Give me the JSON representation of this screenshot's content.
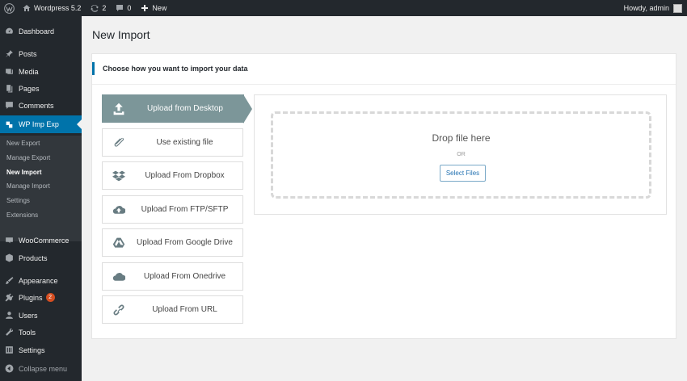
{
  "adminbar": {
    "site_name": "Wordpress 5.2",
    "updates_count": "2",
    "comments_count": "0",
    "new_label": "New",
    "greeting": "Howdy, admin"
  },
  "sidebar": {
    "items": {
      "dashboard": "Dashboard",
      "posts": "Posts",
      "media": "Media",
      "pages": "Pages",
      "comments": "Comments",
      "wp_imp_exp": "WP Imp Exp",
      "woocommerce": "WooCommerce",
      "products": "Products",
      "appearance": "Appearance",
      "plugins": "Plugins",
      "users": "Users",
      "tools": "Tools",
      "settings": "Settings",
      "collapse": "Collapse menu"
    },
    "plugins_badge": "2",
    "submenu": [
      "New Export",
      "Manage Export",
      "New Import",
      "Manage Import",
      "Settings",
      "Extensions"
    ],
    "submenu_current": "New Import",
    "accent_color": "#0073aa"
  },
  "page": {
    "title": "New Import",
    "section_heading": "Choose how you want to import your data"
  },
  "import_options": [
    {
      "label": "Upload from Desktop",
      "icon": "upload-icon",
      "active": true
    },
    {
      "label": "Use existing file",
      "icon": "paperclip-icon",
      "active": false
    },
    {
      "label": "Upload From Dropbox",
      "icon": "dropbox-icon",
      "active": false
    },
    {
      "label": "Upload From FTP/SFTP",
      "icon": "cloud-upload-icon",
      "active": false
    },
    {
      "label": "Upload From Google Drive",
      "icon": "google-drive-icon",
      "active": false
    },
    {
      "label": "Upload From Onedrive",
      "icon": "cloud-icon",
      "active": false
    },
    {
      "label": "Upload From URL",
      "icon": "link-icon",
      "active": false
    }
  ],
  "dropzone": {
    "title": "Drop file here",
    "or_text": "OR",
    "button_label": "Select Files"
  }
}
